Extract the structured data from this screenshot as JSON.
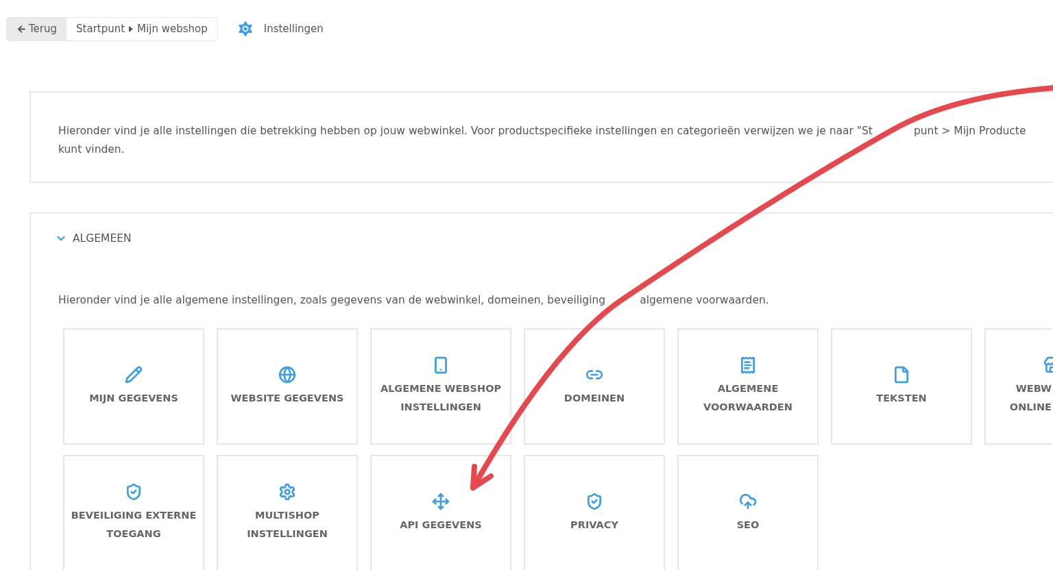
{
  "header": {
    "back_button": "Terug",
    "breadcrumb": [
      "Startpunt",
      "Mijn webshop"
    ],
    "title": "Instellingen"
  },
  "intro": {
    "lines": [
      [
        "Hieronder vind je alle instellingen die betrekking hebben op jouw webwinkel. Voor productspecifieke instellingen en categorieën verwijzen we je naar \"St",
        "punt > Mijn Producte"
      ],
      [
        "kunt vinden."
      ]
    ]
  },
  "section": {
    "title": "ALGEMEEN",
    "expanded": true,
    "description": [
      "Hieronder vind je alle algemene instellingen, zoals gegevens van de webwinkel, domeinen, beveiliging",
      "algemene voorwaarden."
    ],
    "cards": [
      {
        "lines": [
          "MIJN GEGEVENS"
        ],
        "cut": false
      },
      {
        "lines": [
          "WEBSITE GEGEVENS"
        ],
        "cut": false
      },
      {
        "lines": [
          "ALGEMENE WEBSHOP",
          "INSTELLINGEN"
        ],
        "cut": false
      },
      {
        "lines": [
          "DOMEINEN"
        ],
        "cut": false
      },
      {
        "lines": [
          "ALGEMENE",
          "VOORWAARDEN"
        ],
        "cut": false
      },
      {
        "lines": [
          "TEKSTEN"
        ],
        "cut": false
      },
      {
        "lines": [
          "WEBW",
          "ONLINE"
        ],
        "cut": true
      },
      {
        "lines": [
          "BEVEILIGING EXTERNE",
          "TOEGANG"
        ],
        "cut": false
      },
      {
        "lines": [
          "MULTISHOP",
          "INSTELLINGEN"
        ],
        "cut": false
      },
      {
        "lines": [
          "API GEGEVENS"
        ],
        "cut": false
      },
      {
        "lines": [
          "PRIVACY"
        ],
        "cut": false
      },
      {
        "lines": [
          "SEO"
        ],
        "cut": false
      }
    ]
  }
}
